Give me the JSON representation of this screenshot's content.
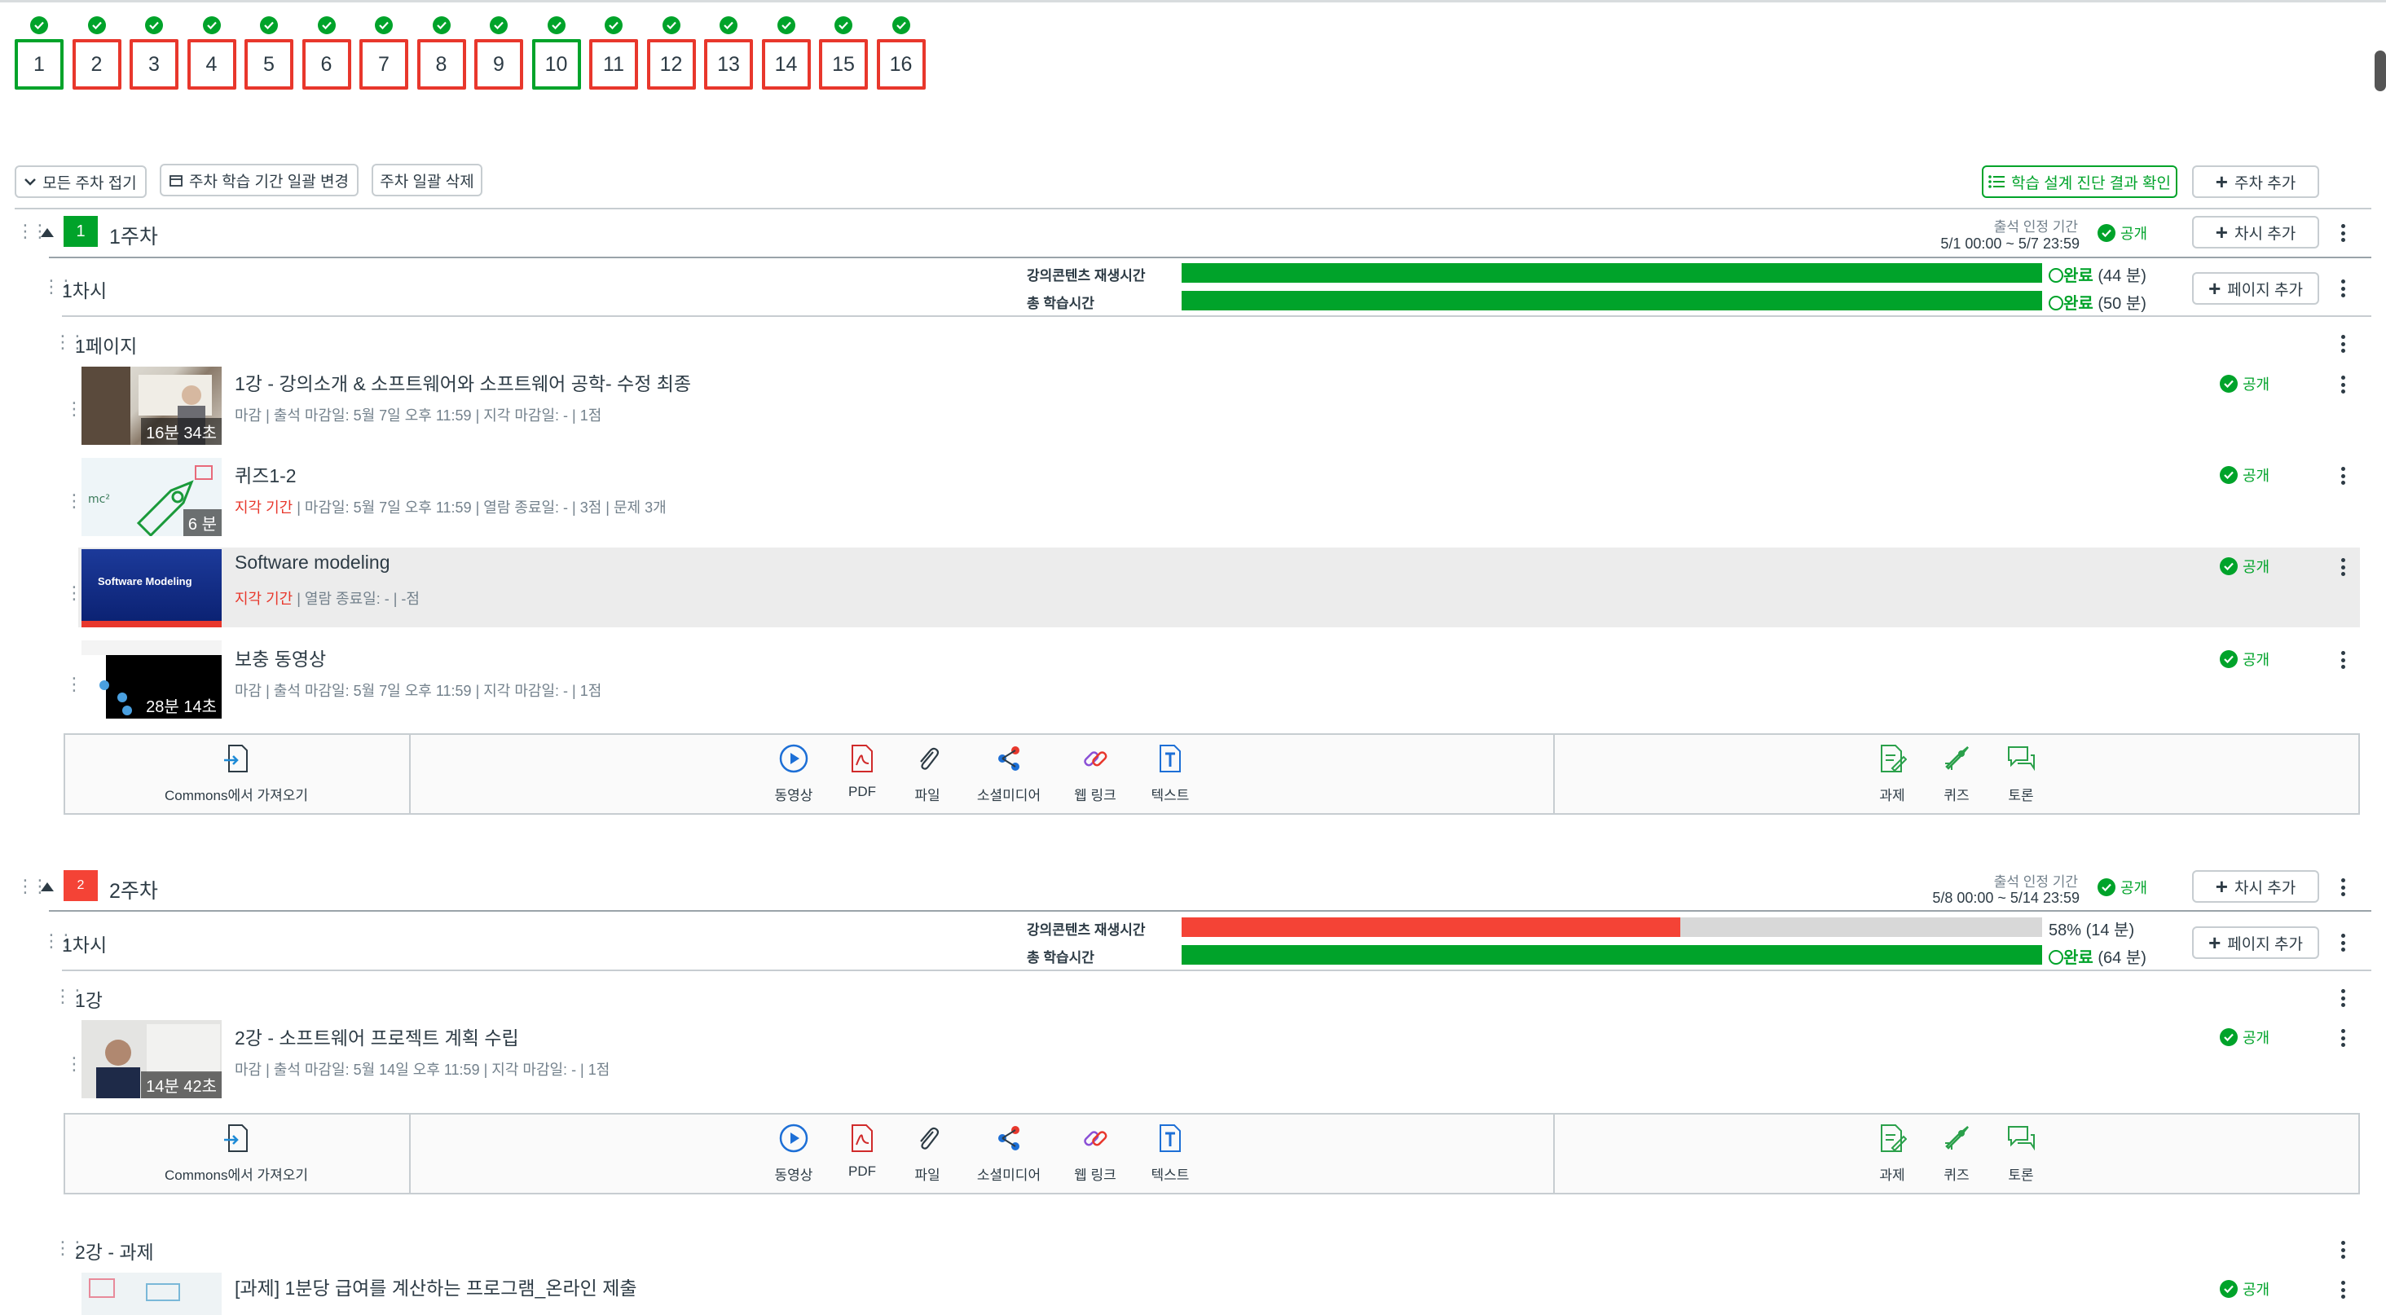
{
  "weeks": [
    {
      "n": "1",
      "done": true
    },
    {
      "n": "2",
      "done": false
    },
    {
      "n": "3",
      "done": false
    },
    {
      "n": "4",
      "done": false
    },
    {
      "n": "5",
      "done": false
    },
    {
      "n": "6",
      "done": false
    },
    {
      "n": "7",
      "done": false
    },
    {
      "n": "8",
      "done": false
    },
    {
      "n": "9",
      "done": false
    },
    {
      "n": "10",
      "done": true
    },
    {
      "n": "11",
      "done": false
    },
    {
      "n": "12",
      "done": false
    },
    {
      "n": "13",
      "done": false
    },
    {
      "n": "14",
      "done": false
    },
    {
      "n": "15",
      "done": false
    },
    {
      "n": "16",
      "done": false
    }
  ],
  "toolbar": {
    "collapse_all": "모든 주차 접기",
    "change_period": "주차 학습 기간 일괄 변경",
    "delete_all": "주차 일괄 삭제",
    "diagnosis": "학습 설계 진단 결과 확인",
    "add_week": "주차 추가"
  },
  "labels": {
    "attendance_period": "출석 인정 기간",
    "public": "공개",
    "add_session": "차시 추가",
    "add_page": "페이지 추가",
    "playtime": "강의콘텐츠 재생시간",
    "total_time": "총 학습시간",
    "complete": "완료"
  },
  "colors": {
    "green": "#00a32a",
    "red": "#f44336",
    "gray": "#d8d8d8"
  },
  "week1": {
    "badge": "1",
    "title": "1주차",
    "period": "5/1 00:00 ~ 5/7 23:59",
    "badge_color": "#00a32a",
    "session": "1차시",
    "playtime_value": "(44 분)",
    "playtime_pct": 100,
    "total_value": "(50 분)",
    "total_pct": 100,
    "page": "1페이지",
    "items": [
      {
        "title": "1강 - 강의소개 & 소프트웨어와 소프트웨어 공학- 수정 최종",
        "duration": "16분 34초",
        "meta_red": "",
        "meta": "마감 | 출석 마감일: 5월 7일 오후 11:59  | 지각 마감일: - | 1점"
      },
      {
        "title": "퀴즈1-2",
        "duration": "6 분",
        "meta_red": "지각 기간",
        "meta": " | 마감일: 5월 7일 오후 11:59  | 열람 종료일: - | 3점 | 문제 3개"
      },
      {
        "title": "Software modeling",
        "duration": "",
        "meta_red": "지각 기간",
        "meta": " | 열람 종료일: - | -점",
        "thumb_text": "Software Modeling"
      },
      {
        "title": "보충 동영상",
        "duration": "28분 14초",
        "meta_red": "",
        "meta": "마감 | 출석 마감일: 5월 7일 오후 11:59  | 지각 마감일: - | 1점"
      }
    ]
  },
  "week2": {
    "badge": "2",
    "title": "2주차",
    "period": "5/8 00:00 ~ 5/14 23:59",
    "badge_color": "#f44336",
    "session": "1차시",
    "playtime_value": "58% (14 분)",
    "playtime_pct": 58,
    "total_value": "(64 분)",
    "total_pct": 100,
    "page": "1강",
    "items": [
      {
        "title": "2강 - 소프트웨어 프로젝트 계획 수립",
        "duration": "14분 42초",
        "meta": "마감 | 출석 마감일: 5월 14일 오후 11:59  | 지각 마감일: - | 1점"
      }
    ],
    "page2": "2강 - 과제",
    "items2": [
      {
        "title": "[과제] 1분당 급여를 계산하는 프로그램_온라인 제출"
      }
    ]
  },
  "tools": {
    "commons": "Commons에서 가져오기",
    "video": "동영상",
    "pdf": "PDF",
    "file": "파일",
    "social": "소셜미디어",
    "weblink": "웹 링크",
    "text": "텍스트",
    "assignment": "과제",
    "quiz": "퀴즈",
    "discussion": "토론"
  }
}
